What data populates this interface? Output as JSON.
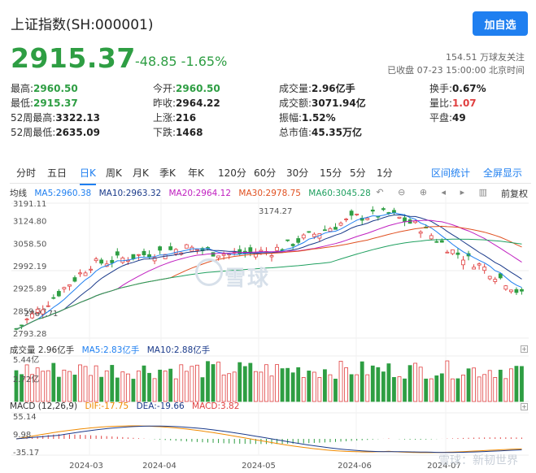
{
  "header": {
    "title": "上证指数(SH:000001)",
    "follow_button": "加自选",
    "price": "2915.37",
    "change": "-48.85 -1.65%",
    "follow_count": "154.51 万球友关注",
    "close_info": "已收盘 07-23 15:00:00 北京时间"
  },
  "stats": [
    {
      "label": "最高:",
      "value": "2960.50",
      "color": "green"
    },
    {
      "label": "今开:",
      "value": "2960.50",
      "color": "green"
    },
    {
      "label": "成交量:",
      "value": "2.96亿手",
      "color": ""
    },
    {
      "label": "换手:",
      "value": "0.67%",
      "color": ""
    },
    {
      "label": "最低:",
      "value": "2915.37",
      "color": "green"
    },
    {
      "label": "昨收:",
      "value": "2964.22",
      "color": ""
    },
    {
      "label": "成交额:",
      "value": "3071.94亿",
      "color": ""
    },
    {
      "label": "量比:",
      "value": "1.07",
      "color": "red"
    },
    {
      "label": "52周最高:",
      "value": "3322.13",
      "color": ""
    },
    {
      "label": "上涨:",
      "value": "216",
      "color": ""
    },
    {
      "label": "振幅:",
      "value": "1.52%",
      "color": ""
    },
    {
      "label": "平盘:",
      "value": "49",
      "color": ""
    },
    {
      "label": "52周最低:",
      "value": "2635.09",
      "color": ""
    },
    {
      "label": "下跌:",
      "value": "1468",
      "color": ""
    },
    {
      "label": "总市值:",
      "value": "45.35万亿",
      "color": ""
    }
  ],
  "tabs": [
    "分时",
    "五日",
    "日K",
    "周K",
    "月K",
    "季K",
    "年K",
    "120分",
    "60分",
    "30分",
    "15分",
    "5分",
    "1分"
  ],
  "active_tab": "日K",
  "tab_right": [
    "区间统计",
    "全屏显示"
  ],
  "price_legend": {
    "label": "均线",
    "ma5": "MA5:2960.38",
    "ma10": "MA10:2963.32",
    "ma20": "MA20:2964.12",
    "ma30": "MA30:2978.75",
    "ma60": "MA60:3045.28"
  },
  "fuquan": "前复权",
  "volume_legend": {
    "label": "成交量 2.96亿手",
    "ma5": "MA5:2.83亿手",
    "ma10": "MA10:2.88亿手"
  },
  "macd_legend": {
    "label": "MACD (12,26,9)",
    "dif": "DIF:-17.75",
    "dea": "DEA:-19.66",
    "macd": "MACD:3.82"
  },
  "watermark": "雪球",
  "footer_mark": "雪球：新韧世界",
  "colors": {
    "up": "#e04040",
    "down": "#2e9e43",
    "ma5": "#1f7ff0",
    "ma10": "#1a3a8a",
    "ma20": "#c020c0",
    "ma30": "#e05020",
    "ma60": "#20a060",
    "dif": "#f08a00",
    "dea": "#1a3a8a",
    "accent": "#1f7ff0"
  },
  "chart_data": {
    "type": "candlestick",
    "y_ticks": [
      "3191.11",
      "3124.80",
      "3058.50",
      "2992.19",
      "2925.89",
      "2859.58",
      "2793.28"
    ],
    "ylim": [
      2793.28,
      3191.11
    ],
    "annotations": [
      {
        "label": "3174.27",
        "value": 3174.27
      },
      {
        "label": "2867.71",
        "value": 2867.71
      }
    ],
    "x_ticks": [
      "2024-03",
      "2024-04",
      "2024-05",
      "2024-06",
      "2024-07"
    ],
    "volume_ticks": [
      "5.44亿",
      "2.72亿"
    ],
    "macd_ticks": [
      "55.14",
      "9.98",
      "-35.17"
    ]
  }
}
